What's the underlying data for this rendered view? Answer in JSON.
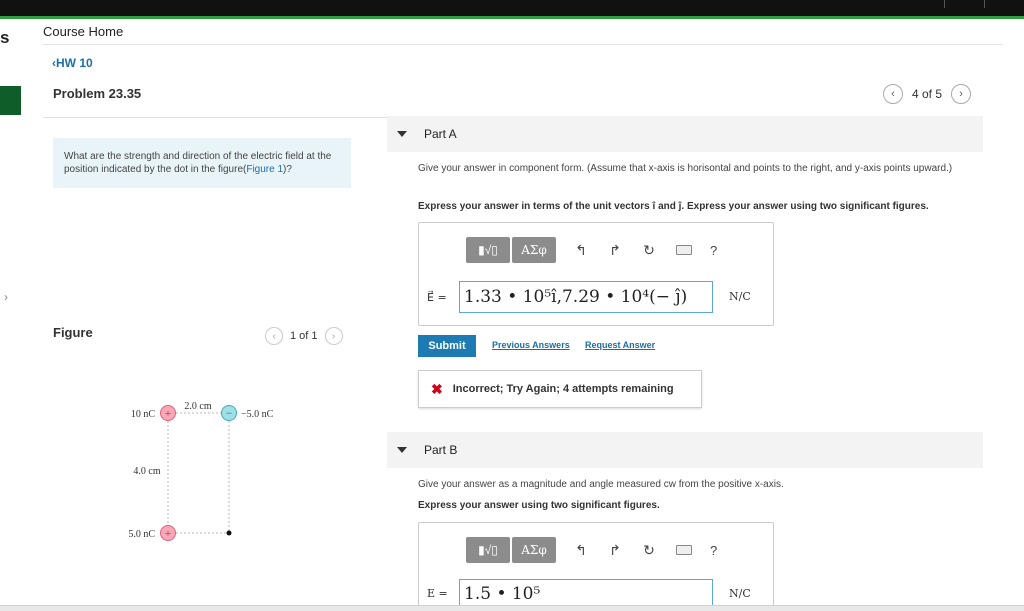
{
  "nav": {
    "course_home": "Course Home",
    "hw_link": "HW 10",
    "left_strip_letter": "s",
    "left_arrow": "›"
  },
  "problem": {
    "title": "Problem 23.35",
    "pager": {
      "prev": "‹",
      "text": "4 of 5",
      "next": "›"
    },
    "question_text": "What are the strength and direction of the electric field at the position indicated by the dot in the figure(",
    "question_link": "Figure 1",
    "question_end": ")?"
  },
  "figure": {
    "label": "Figure",
    "pager": {
      "prev": "‹",
      "text": "1 of 1",
      "next": "›"
    },
    "labels": {
      "q_top_left": "10 nC",
      "q_top_right": "−5.0 nC",
      "q_bottom_left": "5.0 nC",
      "dist_horizontal": "2.0 cm",
      "dist_vertical": "4.0 cm",
      "plus": "+",
      "minus": "−"
    },
    "colors": {
      "positive": "#f7a8b8",
      "negative": "#9fe0e6"
    }
  },
  "part_a": {
    "title": "Part A",
    "instr": "Give your answer in component form. (Assume that x-axis is horisontal and points to the right, and y-axis points upward.)",
    "instr_bold": "Express your answer in terms of the unit vectors î and ĵ. Express your answer using two significant figures.",
    "toolbar": {
      "greek": "ΑΣφ",
      "templates": "▮√▯",
      "undo": "↰",
      "redo": "↱",
      "reset": "↻",
      "help": "?"
    },
    "eq_label": "E⃗ =",
    "answer": "1.33 • 10⁵î,7.29 • 10⁴(− ĵ)",
    "units": "N/C",
    "submit": "Submit",
    "prev_answers": "Previous Answers",
    "request_answer": "Request Answer",
    "feedback": "Incorrect; Try Again; 4 attempts remaining",
    "feedback_icon": "✖"
  },
  "part_b": {
    "title": "Part B",
    "instr": "Give your answer as a magnitude and angle measured cw from the positive x-axis.",
    "instr_bold": "Express your answer using two significant figures.",
    "toolbar": {
      "greek": "ΑΣφ",
      "templates": "▮√▯",
      "undo": "↰",
      "redo": "↱",
      "reset": "↻",
      "help": "?"
    },
    "eq_label": "E =",
    "answer": "1.5 • 10⁵",
    "units": "N/C"
  },
  "colors": {
    "accent": "#1d7ab3",
    "link": "#1a6fa8",
    "error": "#d0021b",
    "topbar_accent": "#2e9e3e"
  }
}
